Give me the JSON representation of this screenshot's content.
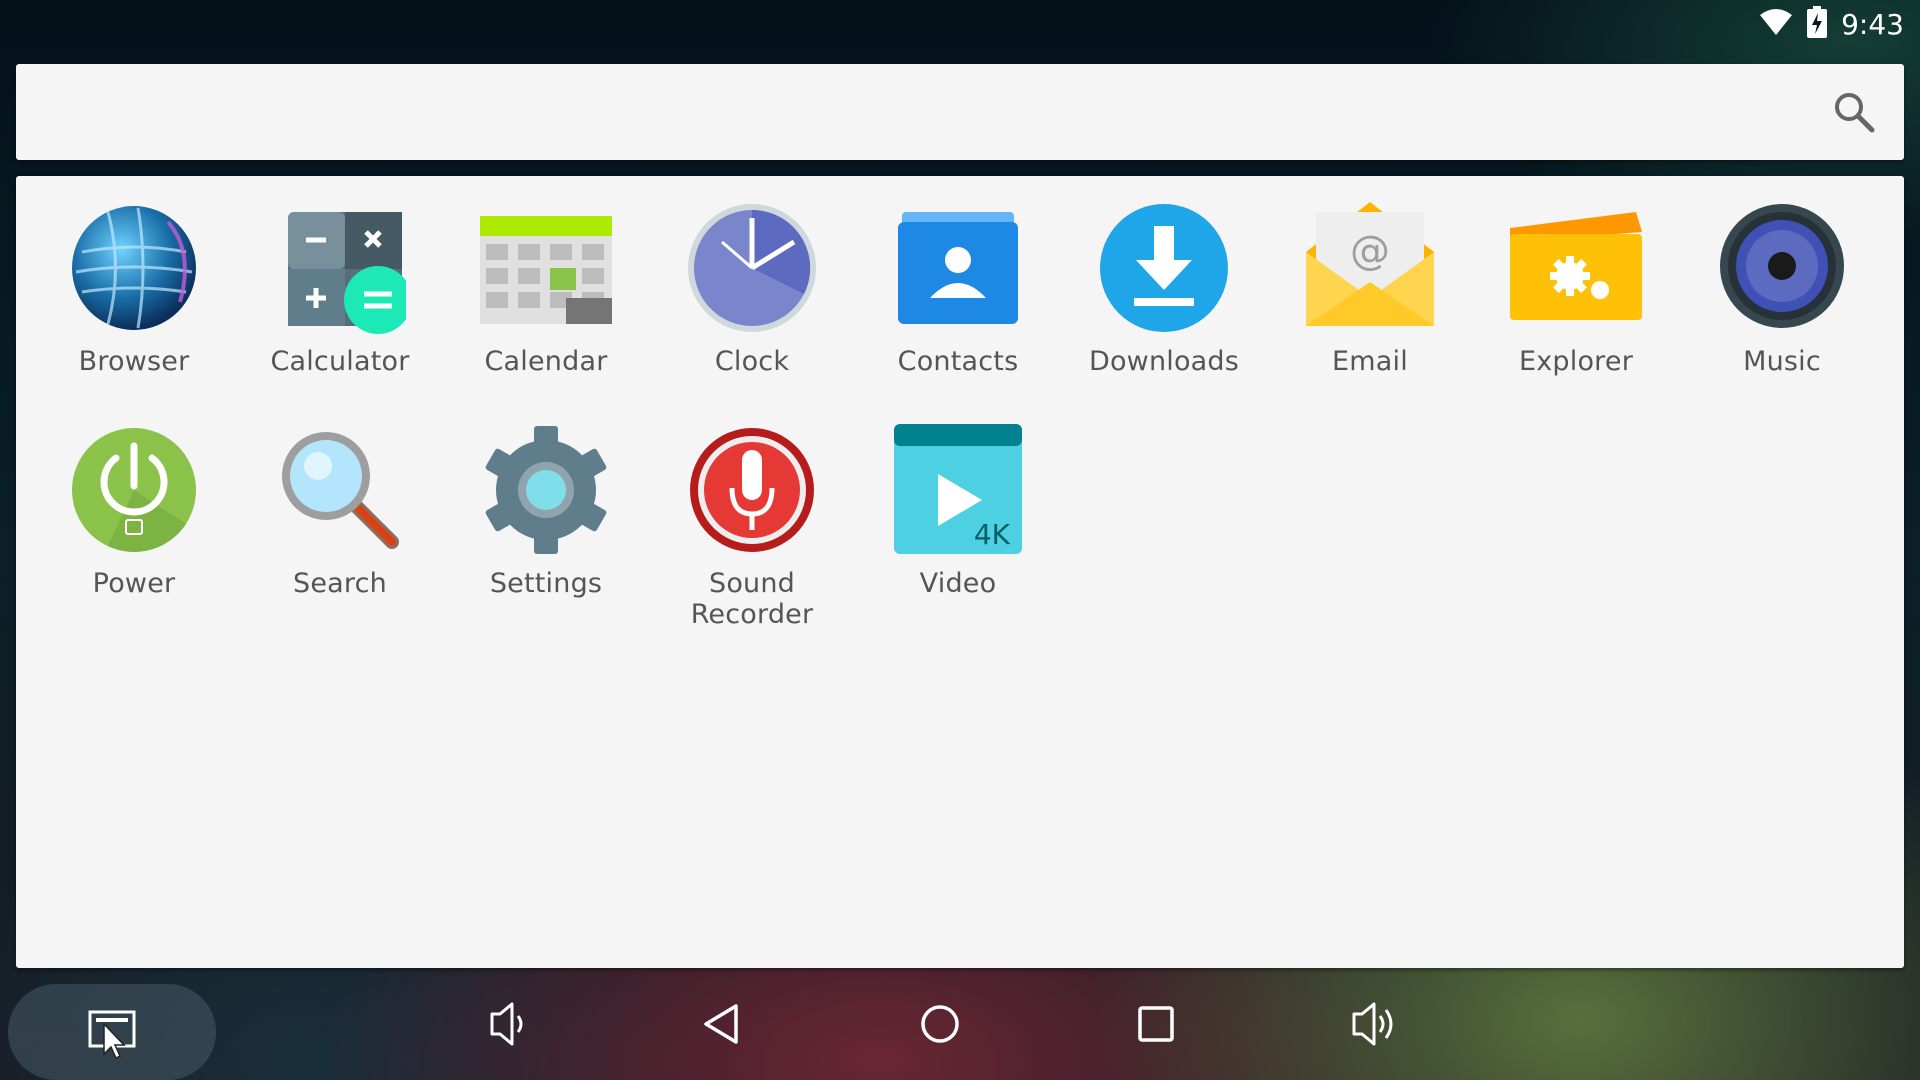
{
  "status_bar": {
    "time": "9:43",
    "icons": [
      "wifi-icon",
      "battery-charging-icon"
    ]
  },
  "search": {
    "placeholder": "",
    "value": "",
    "icon": "search-icon"
  },
  "apps": [
    {
      "label": "Browser",
      "icon": "browser-globe-icon"
    },
    {
      "label": "Calculator",
      "icon": "calculator-icon"
    },
    {
      "label": "Calendar",
      "icon": "calendar-icon"
    },
    {
      "label": "Clock",
      "icon": "clock-icon"
    },
    {
      "label": "Contacts",
      "icon": "contacts-icon"
    },
    {
      "label": "Downloads",
      "icon": "downloads-icon"
    },
    {
      "label": "Email",
      "icon": "email-icon"
    },
    {
      "label": "Explorer",
      "icon": "explorer-folder-icon"
    },
    {
      "label": "Music",
      "icon": "music-speaker-icon"
    },
    {
      "label": "Power",
      "icon": "power-icon"
    },
    {
      "label": "Search",
      "icon": "magnifier-icon"
    },
    {
      "label": "Settings",
      "icon": "settings-gear-icon"
    },
    {
      "label": "Sound Recorder",
      "icon": "microphone-icon"
    },
    {
      "label": "Video",
      "icon": "video-4k-icon"
    }
  ],
  "nav_bar": {
    "buttons": [
      "multiwindow-icon",
      "volume-down-icon",
      "back-icon",
      "home-icon",
      "recents-icon",
      "volume-up-icon"
    ]
  },
  "colors": {
    "panel": "#f5f5f5",
    "label": "#555555",
    "accent_blue": "#1ea6e8",
    "accent_green": "#8bc34a"
  }
}
